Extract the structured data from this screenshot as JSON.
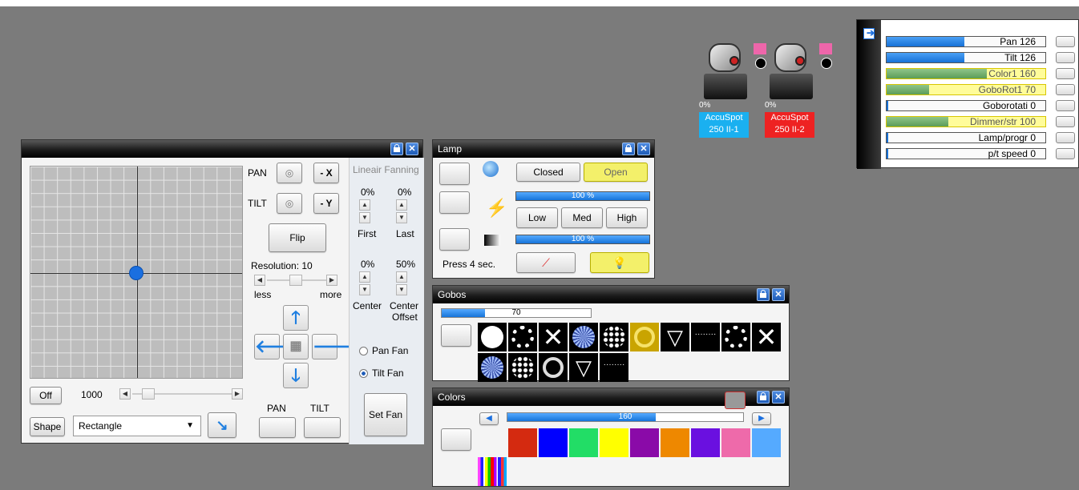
{
  "pt_window": {
    "pan_label": "PAN",
    "tilt_label": "TILT",
    "minus_x": "- X",
    "minus_y": "- Y",
    "flip": "Flip",
    "resolution": "Resolution: 10",
    "less": "less",
    "more": "more",
    "fanning_title": "Lineair Fanning",
    "first_pct": "0%",
    "last_pct": "0%",
    "first": "First",
    "last": "Last",
    "center_pct": "0%",
    "offset_pct": "50%",
    "center": "Center",
    "center2": "Center",
    "offset": "Offset",
    "pan_fan": "Pan Fan",
    "tilt_fan": "Tilt Fan",
    "set_fan": "Set Fan",
    "off": "Off",
    "speed_value": "1000",
    "shape": "Shape",
    "shape_value": "Rectangle",
    "pan_btn": "PAN",
    "tilt_btn": "TILT"
  },
  "lamp_window": {
    "title": "Lamp",
    "closed": "Closed",
    "open": "Open",
    "bar1_text": "100 %",
    "bar1_level": 1.0,
    "low": "Low",
    "med": "Med",
    "high": "High",
    "bar2_text": "100 %",
    "bar2_level": 1.0,
    "press": "Press 4 sec."
  },
  "gobos_window": {
    "title": "Gobos",
    "bar_text": "70",
    "bar_level": 0.29
  },
  "colors_window": {
    "title": "Colors",
    "bar_text": "160",
    "bar_level": 0.63,
    "swatches": [
      "#d42a10",
      "#0000ff",
      "#22dd66",
      "#ffff00",
      "#8a0aa8",
      "#ee8800",
      "#6a10e0",
      "#ee6aaa",
      "#55aaff"
    ]
  },
  "fixtures": [
    {
      "pct": "0%",
      "name_line1": "AccuSpot",
      "name_line2": "250 II-1",
      "color": "#1ab0f0"
    },
    {
      "pct": "0%",
      "name_line1": "AccuSpot",
      "name_line2": "250 II-2",
      "color": "#ee2222"
    }
  ],
  "channels": [
    {
      "label": "Pan   126",
      "level": 0.49,
      "style": "blue"
    },
    {
      "label": "Tilt   126",
      "level": 0.49,
      "style": "blue"
    },
    {
      "label": "Color1   160",
      "level": 0.63,
      "style": "green-hl"
    },
    {
      "label": "GoboRot1   70",
      "level": 0.27,
      "style": "green-hl"
    },
    {
      "label": "Goborotati   0",
      "level": 0.0,
      "style": "plain"
    },
    {
      "label": "Dimmer/str   100",
      "level": 0.39,
      "style": "green-hl"
    },
    {
      "label": "Lamp/progr   0",
      "level": 0.0,
      "style": "plain"
    },
    {
      "label": "p/t speed   0",
      "level": 0.0,
      "style": "plain"
    }
  ]
}
